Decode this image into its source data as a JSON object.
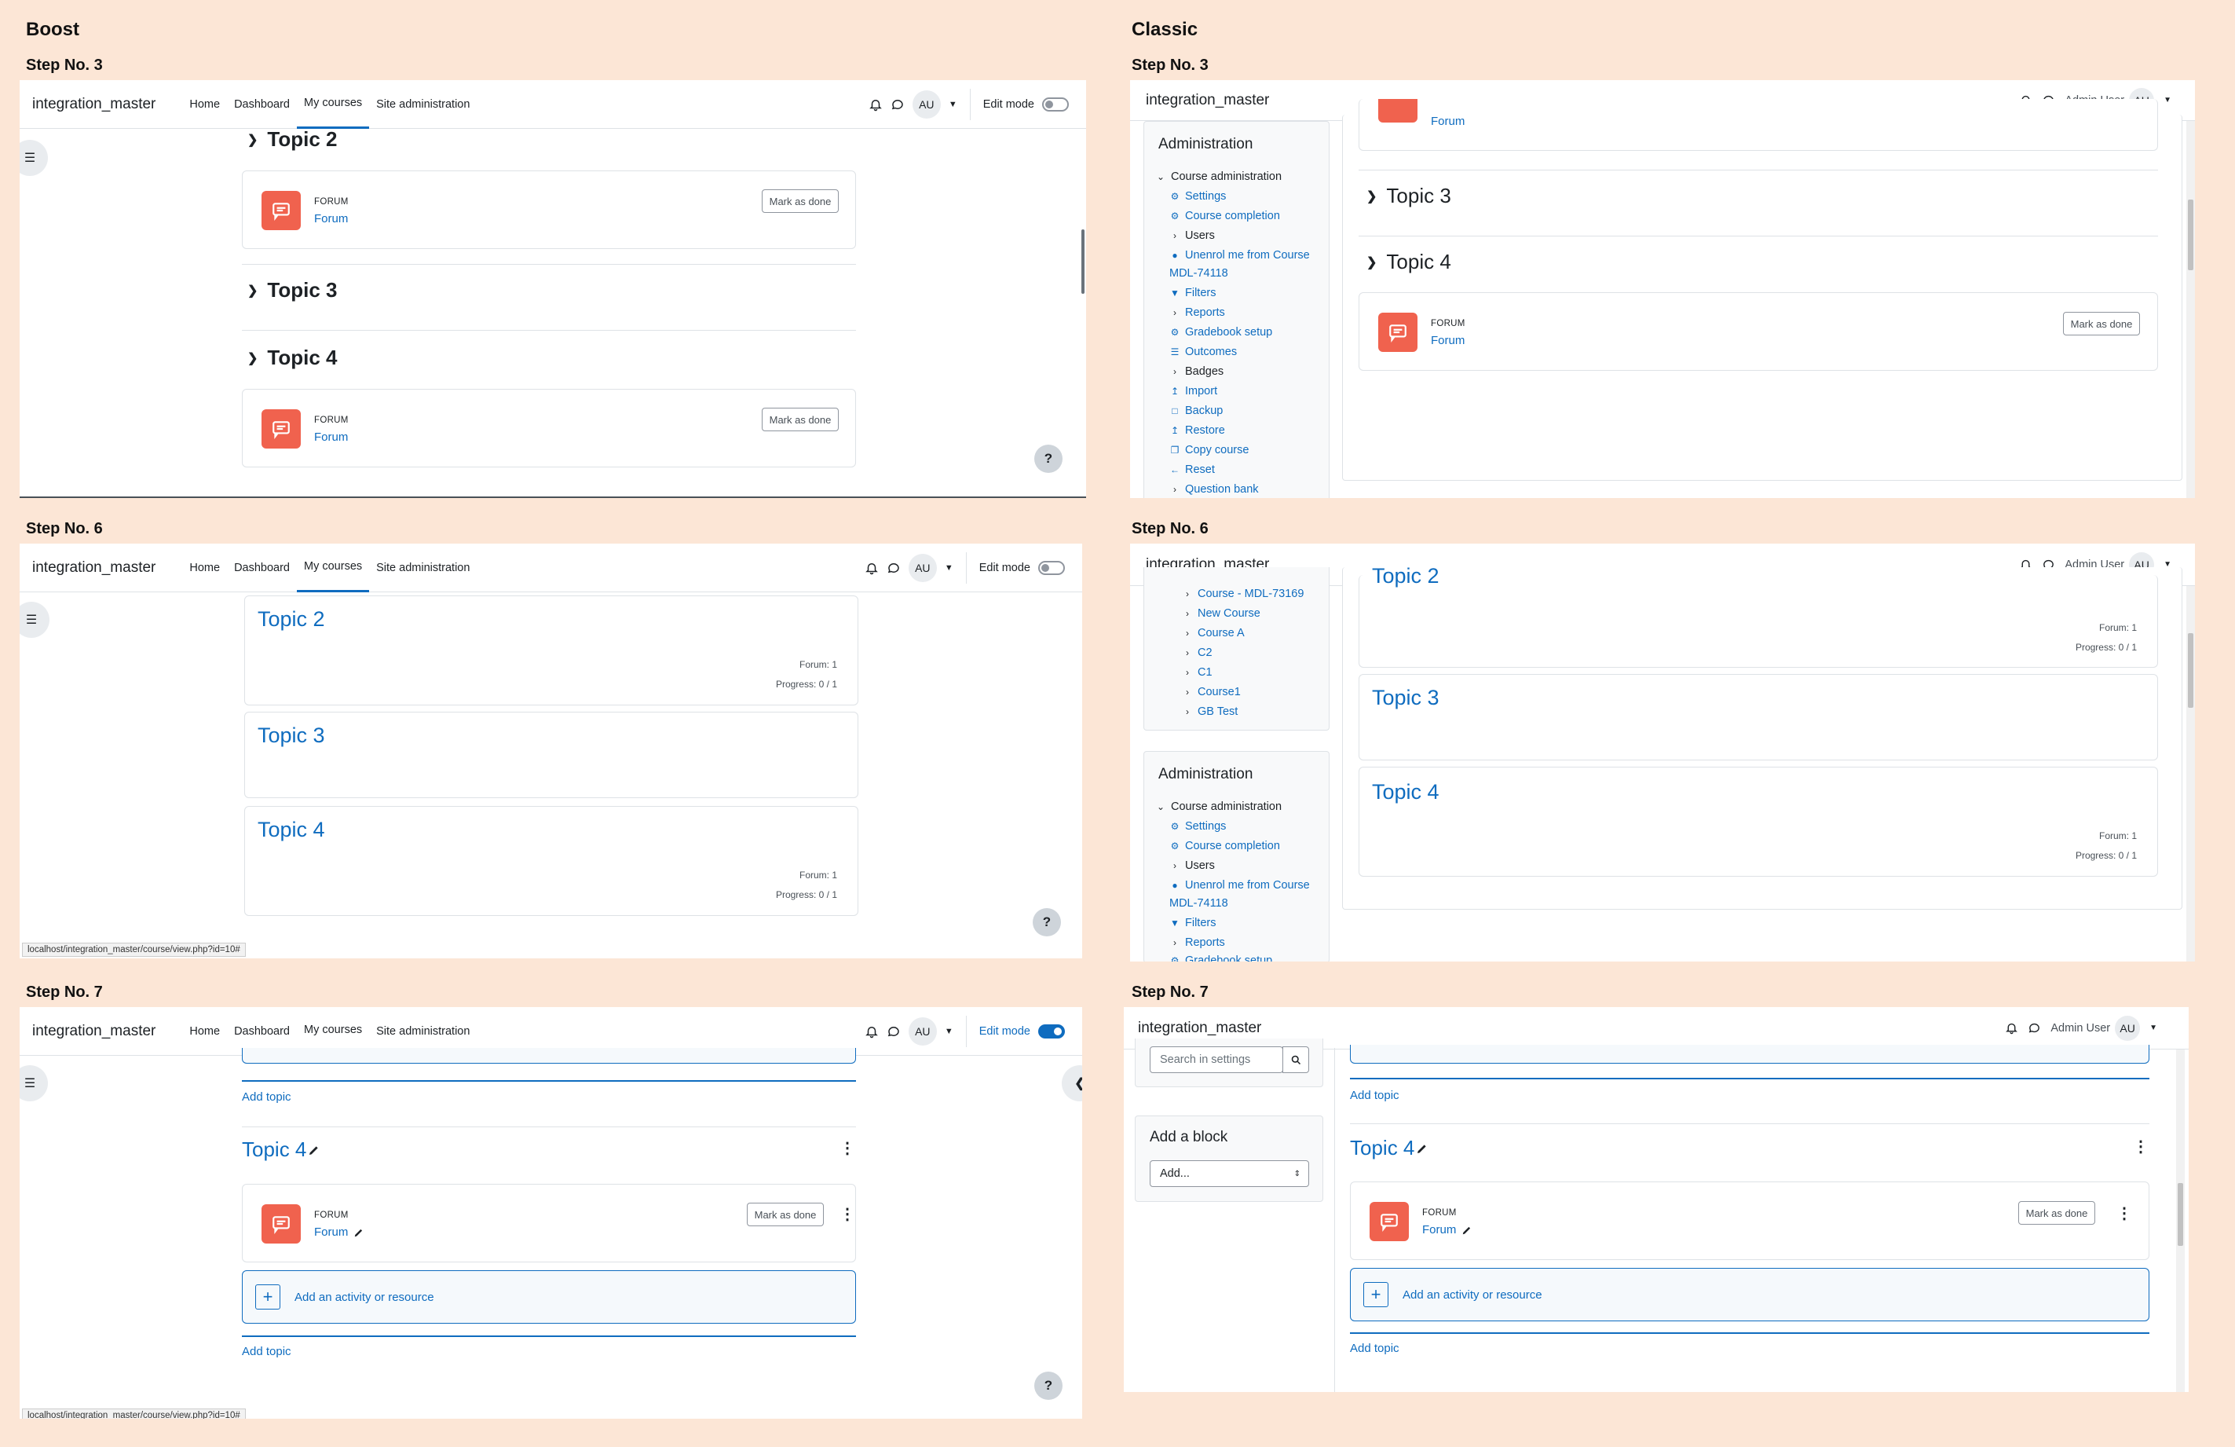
{
  "columns": {
    "left": "Boost",
    "right": "Classic"
  },
  "nav": {
    "site_name": "integration_master",
    "links": [
      "Home",
      "Dashboard",
      "My courses",
      "Site administration"
    ],
    "avatar": "AU",
    "edit_mode": "Edit mode",
    "user_name": "Admin User"
  },
  "activity": {
    "type": "FORUM",
    "name": "Forum",
    "mark_done": "Mark as done"
  },
  "help": "?",
  "boost": {
    "step3": {
      "label": "Step No. 3",
      "topics": [
        "Topic 2",
        "Topic 3",
        "Topic 4"
      ]
    },
    "step6": {
      "label": "Step No. 6",
      "cards": [
        {
          "title": "Topic 2",
          "forum": "Forum: 1",
          "progress": "Progress: 0 / 1"
        },
        {
          "title": "Topic 3"
        },
        {
          "title": "Topic 4",
          "forum": "Forum: 1",
          "progress": "Progress: 0 / 1"
        }
      ],
      "status_url": "localhost/integration_master/course/view.php?id=10#"
    },
    "step7": {
      "label": "Step No. 7",
      "add_topic": "Add topic",
      "topic": "Topic 4",
      "add_activity": "Add an activity or resource",
      "status_url": "localhost/integration_master/course/view.php?id=10#"
    }
  },
  "classic": {
    "step3": {
      "label": "Step No. 3",
      "partial_forum": "Forum",
      "topics": [
        "Topic 3",
        "Topic 4"
      ],
      "admin_block": {
        "title": "Administration",
        "items": [
          {
            "text": "Course administration",
            "kind": "expanded"
          },
          {
            "text": "Settings",
            "icon": "gear-icon"
          },
          {
            "text": "Course completion",
            "icon": "gear-icon"
          },
          {
            "text": "Users",
            "kind": "collapsed"
          },
          {
            "text": "Unenrol me from Course",
            "icon": "user-icon"
          },
          {
            "text": "MDL-74118",
            "kind": "continuation"
          },
          {
            "text": "Filters",
            "icon": "filter-icon"
          },
          {
            "text": "Reports",
            "kind": "collapsed-link"
          },
          {
            "text": "Gradebook setup",
            "icon": "gear-icon"
          },
          {
            "text": "Outcomes",
            "icon": "list-icon"
          },
          {
            "text": "Badges",
            "kind": "collapsed"
          },
          {
            "text": "Import",
            "icon": "upload-icon"
          },
          {
            "text": "Backup",
            "icon": "file-icon"
          },
          {
            "text": "Restore",
            "icon": "upload-icon"
          },
          {
            "text": "Copy course",
            "icon": "copy-icon"
          },
          {
            "text": "Reset",
            "icon": "arrow-left-icon"
          },
          {
            "text": "Question bank",
            "kind": "collapsed-link"
          }
        ]
      }
    },
    "step6": {
      "label": "Step No. 6",
      "course_list": [
        "Course - MDL-73169",
        "New Course",
        "Course A",
        "C2",
        "C1",
        "Course1",
        "GB Test"
      ],
      "partial_topic": "Topic 2",
      "cards": [
        {
          "forum": "Forum: 1",
          "progress": "Progress: 0 / 1"
        },
        {
          "title": "Topic 3"
        },
        {
          "title": "Topic 4",
          "forum": "Forum: 1",
          "progress": "Progress: 0 / 1"
        }
      ],
      "admin_block": {
        "title": "Administration",
        "items": [
          {
            "text": "Course administration",
            "kind": "expanded"
          },
          {
            "text": "Settings",
            "icon": "gear-icon"
          },
          {
            "text": "Course completion",
            "icon": "gear-icon"
          },
          {
            "text": "Users",
            "kind": "collapsed"
          },
          {
            "text": "Unenrol me from Course",
            "icon": "user-icon"
          },
          {
            "text": "MDL-74118",
            "kind": "continuation"
          },
          {
            "text": "Filters",
            "icon": "filter-icon"
          },
          {
            "text": "Reports",
            "kind": "collapsed-link"
          },
          {
            "text": "Gradebook setup",
            "icon": "gear-icon"
          }
        ]
      }
    },
    "step7": {
      "label": "Step No. 7",
      "search_placeholder": "Search in settings",
      "add_block_title": "Add a block",
      "add_block_select": "Add...",
      "add_topic": "Add topic",
      "topic": "Topic 4",
      "add_activity": "Add an activity or resource"
    }
  }
}
